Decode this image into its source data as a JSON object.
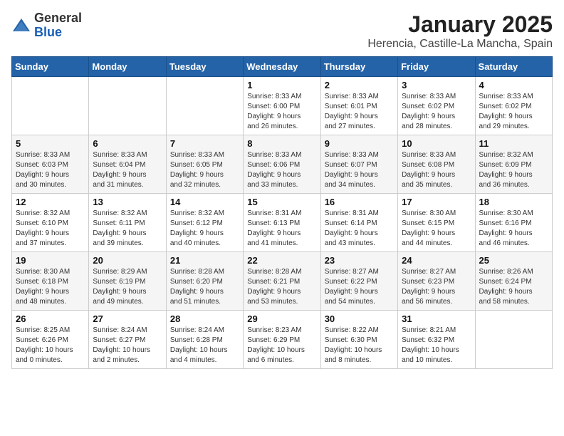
{
  "header": {
    "logo_line1": "General",
    "logo_line2": "Blue",
    "title": "January 2025",
    "subtitle": "Herencia, Castille-La Mancha, Spain"
  },
  "days_of_week": [
    "Sunday",
    "Monday",
    "Tuesday",
    "Wednesday",
    "Thursday",
    "Friday",
    "Saturday"
  ],
  "weeks": [
    [
      {
        "day": "",
        "info": ""
      },
      {
        "day": "",
        "info": ""
      },
      {
        "day": "",
        "info": ""
      },
      {
        "day": "1",
        "info": "Sunrise: 8:33 AM\nSunset: 6:00 PM\nDaylight: 9 hours\nand 26 minutes."
      },
      {
        "day": "2",
        "info": "Sunrise: 8:33 AM\nSunset: 6:01 PM\nDaylight: 9 hours\nand 27 minutes."
      },
      {
        "day": "3",
        "info": "Sunrise: 8:33 AM\nSunset: 6:02 PM\nDaylight: 9 hours\nand 28 minutes."
      },
      {
        "day": "4",
        "info": "Sunrise: 8:33 AM\nSunset: 6:02 PM\nDaylight: 9 hours\nand 29 minutes."
      }
    ],
    [
      {
        "day": "5",
        "info": "Sunrise: 8:33 AM\nSunset: 6:03 PM\nDaylight: 9 hours\nand 30 minutes."
      },
      {
        "day": "6",
        "info": "Sunrise: 8:33 AM\nSunset: 6:04 PM\nDaylight: 9 hours\nand 31 minutes."
      },
      {
        "day": "7",
        "info": "Sunrise: 8:33 AM\nSunset: 6:05 PM\nDaylight: 9 hours\nand 32 minutes."
      },
      {
        "day": "8",
        "info": "Sunrise: 8:33 AM\nSunset: 6:06 PM\nDaylight: 9 hours\nand 33 minutes."
      },
      {
        "day": "9",
        "info": "Sunrise: 8:33 AM\nSunset: 6:07 PM\nDaylight: 9 hours\nand 34 minutes."
      },
      {
        "day": "10",
        "info": "Sunrise: 8:33 AM\nSunset: 6:08 PM\nDaylight: 9 hours\nand 35 minutes."
      },
      {
        "day": "11",
        "info": "Sunrise: 8:32 AM\nSunset: 6:09 PM\nDaylight: 9 hours\nand 36 minutes."
      }
    ],
    [
      {
        "day": "12",
        "info": "Sunrise: 8:32 AM\nSunset: 6:10 PM\nDaylight: 9 hours\nand 37 minutes."
      },
      {
        "day": "13",
        "info": "Sunrise: 8:32 AM\nSunset: 6:11 PM\nDaylight: 9 hours\nand 39 minutes."
      },
      {
        "day": "14",
        "info": "Sunrise: 8:32 AM\nSunset: 6:12 PM\nDaylight: 9 hours\nand 40 minutes."
      },
      {
        "day": "15",
        "info": "Sunrise: 8:31 AM\nSunset: 6:13 PM\nDaylight: 9 hours\nand 41 minutes."
      },
      {
        "day": "16",
        "info": "Sunrise: 8:31 AM\nSunset: 6:14 PM\nDaylight: 9 hours\nand 43 minutes."
      },
      {
        "day": "17",
        "info": "Sunrise: 8:30 AM\nSunset: 6:15 PM\nDaylight: 9 hours\nand 44 minutes."
      },
      {
        "day": "18",
        "info": "Sunrise: 8:30 AM\nSunset: 6:16 PM\nDaylight: 9 hours\nand 46 minutes."
      }
    ],
    [
      {
        "day": "19",
        "info": "Sunrise: 8:30 AM\nSunset: 6:18 PM\nDaylight: 9 hours\nand 48 minutes."
      },
      {
        "day": "20",
        "info": "Sunrise: 8:29 AM\nSunset: 6:19 PM\nDaylight: 9 hours\nand 49 minutes."
      },
      {
        "day": "21",
        "info": "Sunrise: 8:28 AM\nSunset: 6:20 PM\nDaylight: 9 hours\nand 51 minutes."
      },
      {
        "day": "22",
        "info": "Sunrise: 8:28 AM\nSunset: 6:21 PM\nDaylight: 9 hours\nand 53 minutes."
      },
      {
        "day": "23",
        "info": "Sunrise: 8:27 AM\nSunset: 6:22 PM\nDaylight: 9 hours\nand 54 minutes."
      },
      {
        "day": "24",
        "info": "Sunrise: 8:27 AM\nSunset: 6:23 PM\nDaylight: 9 hours\nand 56 minutes."
      },
      {
        "day": "25",
        "info": "Sunrise: 8:26 AM\nSunset: 6:24 PM\nDaylight: 9 hours\nand 58 minutes."
      }
    ],
    [
      {
        "day": "26",
        "info": "Sunrise: 8:25 AM\nSunset: 6:26 PM\nDaylight: 10 hours\nand 0 minutes."
      },
      {
        "day": "27",
        "info": "Sunrise: 8:24 AM\nSunset: 6:27 PM\nDaylight: 10 hours\nand 2 minutes."
      },
      {
        "day": "28",
        "info": "Sunrise: 8:24 AM\nSunset: 6:28 PM\nDaylight: 10 hours\nand 4 minutes."
      },
      {
        "day": "29",
        "info": "Sunrise: 8:23 AM\nSunset: 6:29 PM\nDaylight: 10 hours\nand 6 minutes."
      },
      {
        "day": "30",
        "info": "Sunrise: 8:22 AM\nSunset: 6:30 PM\nDaylight: 10 hours\nand 8 minutes."
      },
      {
        "day": "31",
        "info": "Sunrise: 8:21 AM\nSunset: 6:32 PM\nDaylight: 10 hours\nand 10 minutes."
      },
      {
        "day": "",
        "info": ""
      }
    ]
  ]
}
